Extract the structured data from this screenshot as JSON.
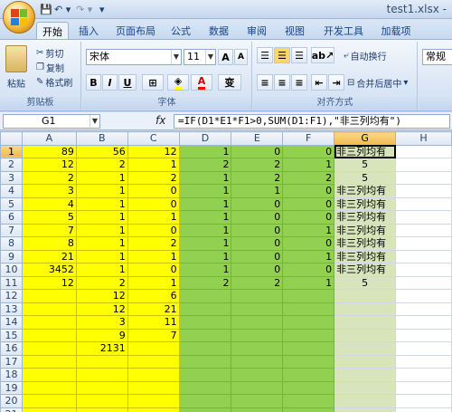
{
  "title": "test1.xlsx - ",
  "quick_access": {
    "save_icon": "💾",
    "undo": "↶ ▾",
    "redo": "↷ ▾",
    "customize": "▾"
  },
  "tabs": [
    "开始",
    "插入",
    "页面布局",
    "公式",
    "数据",
    "审阅",
    "视图",
    "开发工具",
    "加载项"
  ],
  "clipboard": {
    "paste": "粘贴",
    "cut": "剪切",
    "copy": "复制",
    "format_painter": "格式刷",
    "label": "剪贴板"
  },
  "font": {
    "name": "宋体",
    "size": "11",
    "bold": "B",
    "italic": "I",
    "underline": "U",
    "grow": "A",
    "shrink": "A",
    "phonetic": "变",
    "label": "字体"
  },
  "alignment": {
    "wrap": "自动换行",
    "merge": "合并后居中",
    "label": "对齐方式"
  },
  "number": {
    "format": "常规"
  },
  "formula_bar": {
    "name_box": "G1",
    "fx": "fx",
    "formula": "=IF(D1*E1*F1>0,SUM(D1:F1),\"非三列均有\")"
  },
  "columns": [
    "A",
    "B",
    "C",
    "D",
    "E",
    "F",
    "G",
    "H"
  ],
  "rows": [
    {
      "n": "1",
      "a": "89",
      "b": "56",
      "c": "12",
      "d": "1",
      "e": "0",
      "f": "0",
      "g": "非三列均有"
    },
    {
      "n": "2",
      "a": "12",
      "b": "2",
      "c": "1",
      "d": "2",
      "e": "2",
      "f": "1",
      "g": "5"
    },
    {
      "n": "3",
      "a": "2",
      "b": "1",
      "c": "2",
      "d": "1",
      "e": "2",
      "f": "2",
      "g": "5"
    },
    {
      "n": "4",
      "a": "3",
      "b": "1",
      "c": "0",
      "d": "1",
      "e": "1",
      "f": "0",
      "g": "非三列均有"
    },
    {
      "n": "5",
      "a": "4",
      "b": "1",
      "c": "0",
      "d": "1",
      "e": "0",
      "f": "0",
      "g": "非三列均有"
    },
    {
      "n": "6",
      "a": "5",
      "b": "1",
      "c": "1",
      "d": "1",
      "e": "0",
      "f": "0",
      "g": "非三列均有"
    },
    {
      "n": "7",
      "a": "7",
      "b": "1",
      "c": "0",
      "d": "1",
      "e": "0",
      "f": "1",
      "g": "非三列均有"
    },
    {
      "n": "8",
      "a": "8",
      "b": "1",
      "c": "2",
      "d": "1",
      "e": "0",
      "f": "0",
      "g": "非三列均有"
    },
    {
      "n": "9",
      "a": "21",
      "b": "1",
      "c": "1",
      "d": "1",
      "e": "0",
      "f": "1",
      "g": "非三列均有"
    },
    {
      "n": "10",
      "a": "3452",
      "b": "1",
      "c": "0",
      "d": "1",
      "e": "0",
      "f": "0",
      "g": "非三列均有"
    },
    {
      "n": "11",
      "a": "12",
      "b": "2",
      "c": "1",
      "d": "2",
      "e": "2",
      "f": "1",
      "g": "5"
    },
    {
      "n": "12",
      "a": "",
      "b": "12",
      "c": "6",
      "d": "",
      "e": "",
      "f": "",
      "g": ""
    },
    {
      "n": "13",
      "a": "",
      "b": "12",
      "c": "21",
      "d": "",
      "e": "",
      "f": "",
      "g": ""
    },
    {
      "n": "14",
      "a": "",
      "b": "3",
      "c": "11",
      "d": "",
      "e": "",
      "f": "",
      "g": ""
    },
    {
      "n": "15",
      "a": "",
      "b": "9",
      "c": "7",
      "d": "",
      "e": "",
      "f": "",
      "g": ""
    },
    {
      "n": "16",
      "a": "",
      "b": "2131",
      "c": "",
      "d": "",
      "e": "",
      "f": "",
      "g": ""
    },
    {
      "n": "17",
      "a": "",
      "b": "",
      "c": "",
      "d": "",
      "e": "",
      "f": "",
      "g": ""
    },
    {
      "n": "18",
      "a": "",
      "b": "",
      "c": "",
      "d": "",
      "e": "",
      "f": "",
      "g": ""
    },
    {
      "n": "19",
      "a": "",
      "b": "",
      "c": "",
      "d": "",
      "e": "",
      "f": "",
      "g": ""
    },
    {
      "n": "20",
      "a": "",
      "b": "",
      "c": "",
      "d": "",
      "e": "",
      "f": "",
      "g": ""
    },
    {
      "n": "21",
      "a": "",
      "b": "",
      "c": "",
      "d": "",
      "e": "",
      "f": "",
      "g": ""
    }
  ],
  "colors": {
    "yellow": "#ffff00",
    "green": "#92d050",
    "light_green": "#d8e4bc"
  }
}
